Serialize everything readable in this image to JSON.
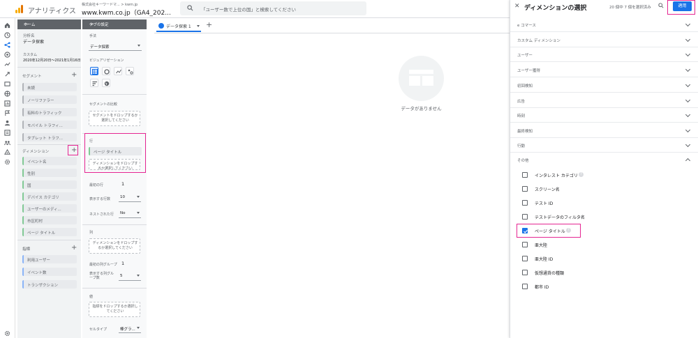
{
  "header": {
    "app_name": "アナリティクス",
    "account": "株式会社キーワードマ... > kwm.jp",
    "property": "www.kwm.co.jp（GA4_202...",
    "search_placeholder": "「ユーザー数で上位の国」と検索してください"
  },
  "rail": {
    "icons": [
      "home-icon",
      "reports-icon",
      "explore-icon",
      "advertising-icon",
      "acquisition-icon",
      "engagement-icon",
      "monetization-icon",
      "retention-icon",
      "demographics-icon",
      "tech-icon",
      "user-icon",
      "configure-icon",
      "library-icon",
      "debug-icon",
      "settings-icon"
    ]
  },
  "variables": {
    "header": "ホーム",
    "analysis_label": "分析名",
    "analysis_name": "データ探索",
    "date_label": "カスタム",
    "date_range": "2020年12月20日～2021年1月16日",
    "segments_title": "セグメント",
    "segments": [
      "未読",
      "ノーリファラー",
      "有料のトラフィック",
      "モバイル トラフィ...",
      "タブレット トラフ..."
    ],
    "dimensions_title": "ディメンション",
    "dimensions": [
      "イベント名",
      "性別",
      "国",
      "デバイス カテゴリ",
      "ユーザーのメディ...",
      "市区町村",
      "ページ タイトル"
    ],
    "metrics_title": "指標",
    "metrics": [
      "利用ユーザー",
      "イベント数",
      "トランザクション"
    ]
  },
  "tab_settings": {
    "header": "タブの設定",
    "technique_label": "手法",
    "technique_value": "データ探索",
    "visualization_label": "ビジュアリゼーション",
    "segment_compare_label": "セグメントの比較",
    "segment_drop": "セグメントをドロップするか選択してください",
    "rows_label": "行",
    "row_chip": "ページ タイトル",
    "row_drop": "ディメンションをドロップするか選択してください",
    "start_row_label": "最初の行",
    "start_row_value": "1",
    "show_rows_label": "表示する行数",
    "show_rows_value": "10",
    "nested_label": "ネストされた行",
    "nested_value": "No",
    "cols_label": "列",
    "col_drop": "ディメンションをドロップするか選択してください",
    "start_col_label": "最初の列グループ",
    "start_col_value": "1",
    "show_cols_label": "表示する列グループ数",
    "show_cols_value": "5",
    "values_label": "値",
    "values_drop": "指標をドロップするか選択してください",
    "cell_type_label": "セルタイプ",
    "cell_type_value": "棒グラ..."
  },
  "canvas": {
    "tab_label": "データ探索 1",
    "add_tab": "+",
    "no_data": "データがありません"
  },
  "picker": {
    "title": "ディメンションの選択",
    "selection_count": "20 個中 7 個を選択済み",
    "apply_label": "適用",
    "categories": [
      "e コマース",
      "カスタム ディメンション",
      "ユーザー",
      "ユーザー獲得",
      "初回検知",
      "広告",
      "時刻",
      "最終検知",
      "行動",
      "その他"
    ],
    "options": [
      {
        "label": "インタレスト カテゴリ",
        "checked": false,
        "help": true
      },
      {
        "label": "スクリーン名",
        "checked": false,
        "help": false
      },
      {
        "label": "テスト ID",
        "checked": false,
        "help": false
      },
      {
        "label": "テストデータのフィルタ名",
        "checked": false,
        "help": false
      },
      {
        "label": "ページ タイトル",
        "checked": true,
        "help": true
      },
      {
        "label": "亜大陸",
        "checked": false,
        "help": false
      },
      {
        "label": "亜大陸 ID",
        "checked": false,
        "help": false
      },
      {
        "label": "仮想通貨の種類",
        "checked": false,
        "help": false
      },
      {
        "label": "都市 ID",
        "checked": false,
        "help": false
      }
    ]
  },
  "colors": {
    "accent": "#1a73e8",
    "highlight": "#e52592",
    "logo": "#f9ab00"
  }
}
